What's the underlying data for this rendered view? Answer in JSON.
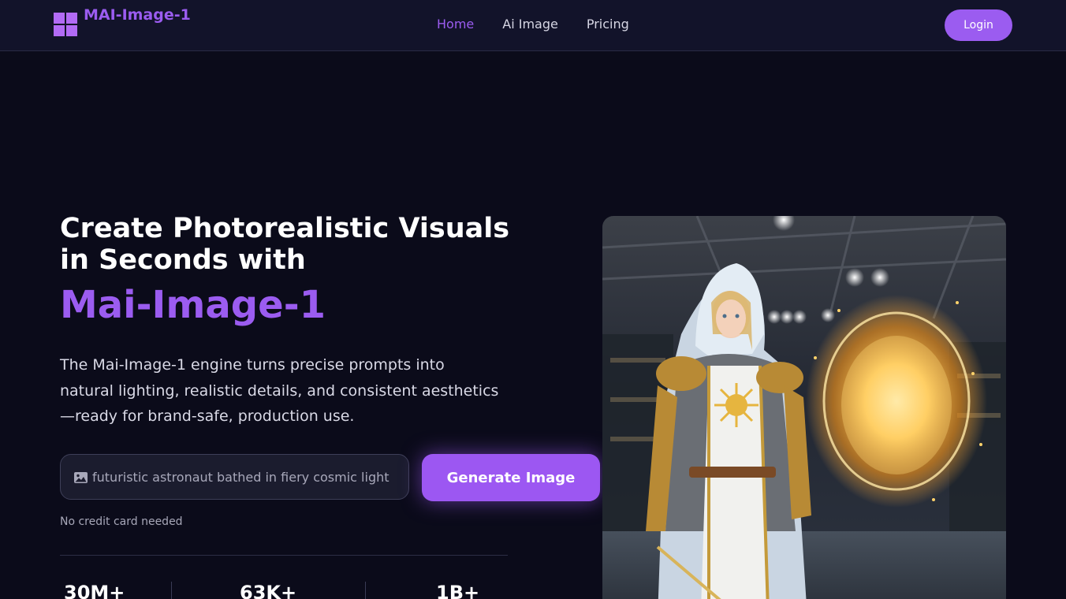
{
  "brand": {
    "name": "MAI-Image-1",
    "logo_icon": "grid-logo-icon"
  },
  "nav": {
    "links": [
      {
        "label": "Home",
        "active": true
      },
      {
        "label": "Ai Image",
        "active": false
      },
      {
        "label": "Pricing",
        "active": false
      }
    ],
    "login_label": "Login"
  },
  "hero": {
    "title": "Create Photorealistic Visuals in Seconds with",
    "title_accent": "Mai-Image-1",
    "description": "The Mai-Image-1 engine turns precise prompts into natural lighting, realistic details, and consistent aesthetics—ready for brand-safe, production use.",
    "prompt": {
      "placeholder": "futuristic astronaut bathed in fiery cosmic light",
      "value": "",
      "icon": "image-icon"
    },
    "generate_label": "Generate Image",
    "note": "No credit card needed",
    "stats": [
      "30M+",
      "63K+",
      "1B+"
    ]
  },
  "colors": {
    "accent": "#9b5cf0",
    "background": "#0b0b1a",
    "navbar": "#12132a"
  }
}
